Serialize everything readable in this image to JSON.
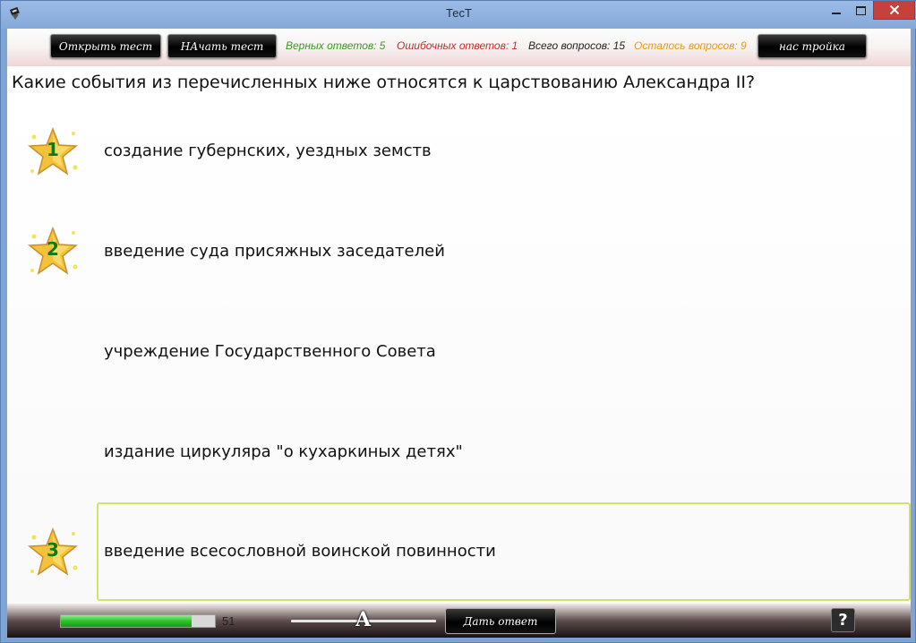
{
  "window": {
    "title": "ТесТ",
    "min_glyph": "—",
    "max_glyph": "☐",
    "close_glyph": "✕"
  },
  "toolbar": {
    "open_label": "Открыть тест",
    "start_label": "НАчать тест",
    "settings_label": "нас тройка",
    "correct_text": "Верных ответов: 5",
    "wrong_text": "Ошибочных ответов: 1",
    "total_text": "Всего вопросов: 15",
    "left_text": "Осталось вопросов: 9",
    "colors": {
      "correct": "#3a9a21",
      "wrong": "#c62b2b",
      "left": "#e79a17"
    }
  },
  "question": "Какие события из перечисленных ниже относятся к царствованию Александра II?",
  "answers": [
    {
      "text": "создание губернских, уездных земств",
      "order": "1",
      "selected": false
    },
    {
      "text": "введение суда присяжных заседателей",
      "order": "2",
      "selected": false
    },
    {
      "text": "учреждение Государственного Совета",
      "order": "",
      "selected": false
    },
    {
      "text": "издание циркуляра \"о кухаркиных детях\"",
      "order": "",
      "selected": false
    },
    {
      "text": "введение всесословной воинской повинности",
      "order": "3",
      "selected": true
    }
  ],
  "bottom": {
    "progress_value": 51,
    "progress_fraction": 0.85,
    "slider_glyph": "A",
    "slider_fraction": 0.5,
    "answer_label": "Дать ответ",
    "help_label": "?"
  }
}
